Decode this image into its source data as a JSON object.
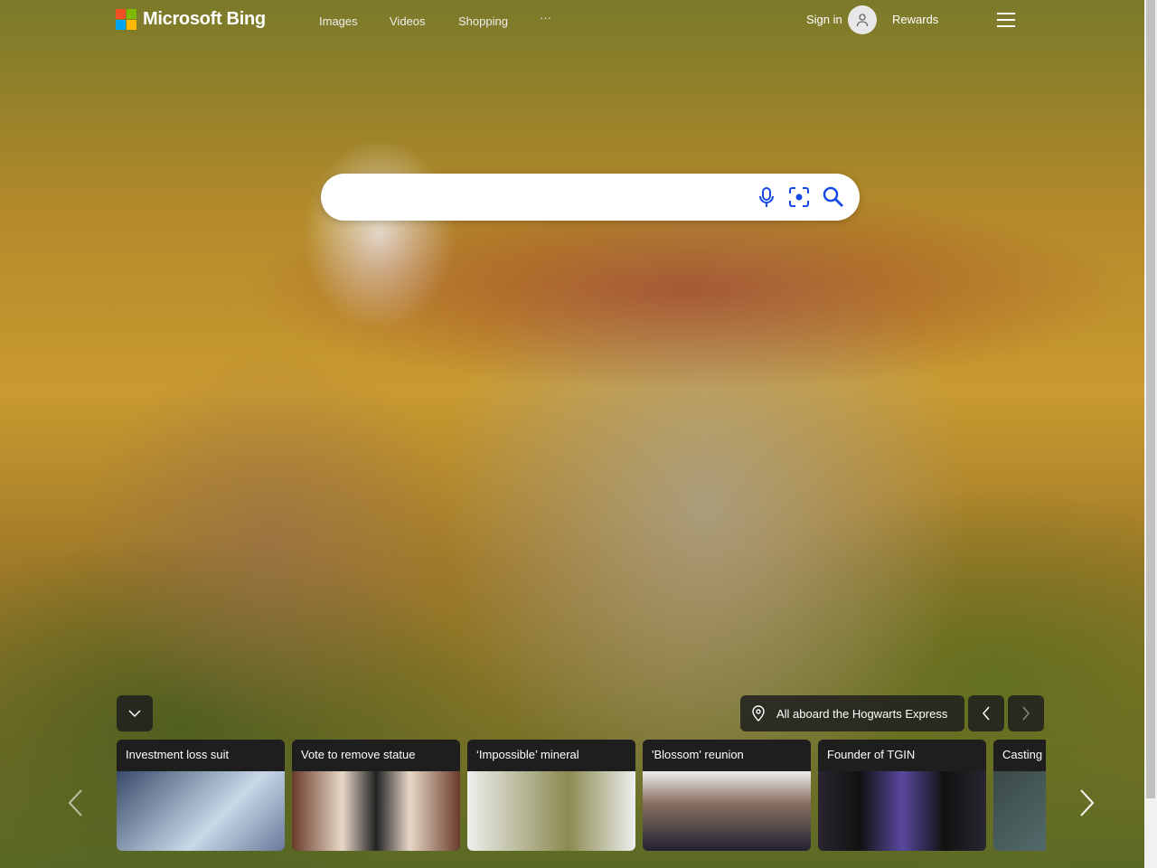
{
  "header": {
    "brand": "Microsoft Bing",
    "nav": [
      "Images",
      "Videos",
      "Shopping",
      "···"
    ],
    "sign_in": "Sign in",
    "rewards": "Rewards"
  },
  "search": {
    "value": "",
    "placeholder": ""
  },
  "location": {
    "caption": "All aboard the Hogwarts Express"
  },
  "cards": [
    {
      "title": "Investment loss suit",
      "color": "#3a4a6a"
    },
    {
      "title": "Vote to remove statue",
      "color": "#6a3a2a"
    },
    {
      "title": "‘Impossible’ mineral",
      "color": "#c9c9b0"
    },
    {
      "title": "'Blossom' reunion",
      "color": "#8a7060"
    },
    {
      "title": "Founder of TGIN",
      "color": "#2a2530"
    },
    {
      "title": "Casting",
      "color": "#3a4848"
    }
  ]
}
